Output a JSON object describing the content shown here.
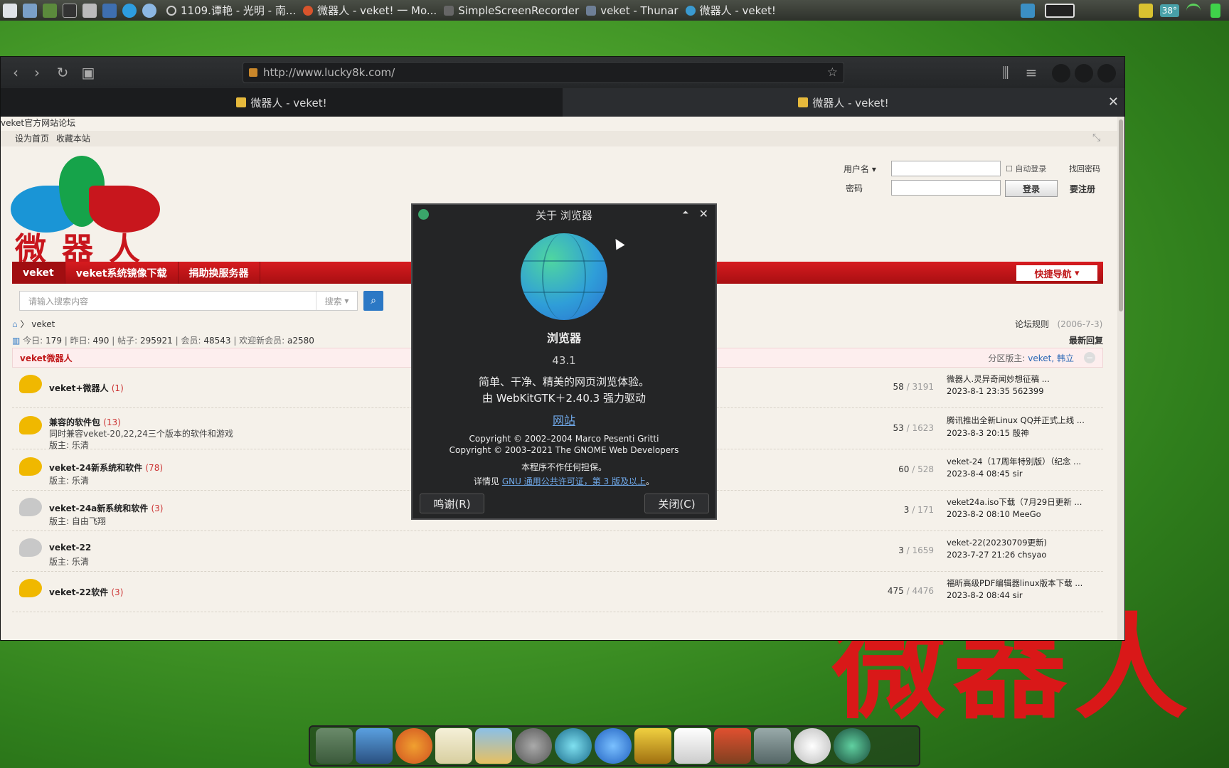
{
  "panel": {
    "tasks": [
      "1109.谭艳 - 光明 - 南...",
      "微器人 - veket! 一 Mo...",
      "SimpleScreenRecorder",
      "veket - Thunar",
      "微器人 - veket!"
    ],
    "temp": "38°"
  },
  "browser": {
    "url": "http://www.lucky8k.com/",
    "tabs": [
      "微器人 - veket!",
      "微器人 - veket!"
    ]
  },
  "site": {
    "top_text": "veket官方网站论坛",
    "header_links": "设为首页 收藏本站",
    "brand": "微器人",
    "login": {
      "user_label": "用户名",
      "pass_label": "密码",
      "auto_login": "自动登录",
      "find_pw": "找回密码",
      "login_btn": "登录",
      "register": "要注册"
    },
    "nav": [
      "veket",
      "veket系统镜像下载",
      "捐助换服务器"
    ],
    "quick_nav": "快捷导航",
    "search": {
      "placeholder": "请输入搜索内容",
      "type": "搜索"
    },
    "breadcrumb": "veket",
    "rules": "论坛规则",
    "rules_date": "(2006-7-3)",
    "stats": {
      "today_l": "今日:",
      "today": "179",
      "yest_l": "昨日:",
      "yest": "490",
      "posts_l": "帖子:",
      "posts": "295921",
      "members_l": "会员:",
      "members": "48543",
      "welcome_l": "欢迎新会员:",
      "newest": "a2580"
    },
    "latest_reply": "最新回复",
    "section": {
      "title": "veket微器人",
      "mods_label": "分区版主:",
      "mods": "veket, 韩立"
    },
    "forums": [
      {
        "name": "veket+微器人",
        "count": "(1)",
        "desc": "",
        "mod": "",
        "threads": "58",
        "posts": "3191",
        "last": "微器人.灵异奇闻妙想征稿 ...",
        "last_meta": "2023-8-1 23:35 562399",
        "icon": "#f0b800"
      },
      {
        "name": "兼容的软件包",
        "count": "(13)",
        "desc": "同时兼容veket-20,22,24三个版本的软件和游戏",
        "mod": "版主: 乐清",
        "threads": "53",
        "posts": "1623",
        "last": "腾讯推出全新Linux QQ并正式上线 ...",
        "last_meta": "2023-8-3 20:15 殷神",
        "icon": "#f0b800"
      },
      {
        "name": "veket-24新系统和软件",
        "count": "(78)",
        "desc": "",
        "mod": "版主: 乐清",
        "threads": "60",
        "posts": "528",
        "last": "veket-24（17周年特别版）（纪念 ...",
        "last_meta": "2023-8-4 08:45 sir",
        "icon": "#f0b800"
      },
      {
        "name": "veket-24a新系统和软件",
        "count": "(3)",
        "desc": "",
        "mod": "版主: 自由飞翔",
        "threads": "3",
        "posts": "171",
        "last": "veket24a.iso下载（7月29日更新 ...",
        "last_meta": "2023-8-2 08:10 MeeGo",
        "icon": "#c8c8c8"
      },
      {
        "name": "veket-22",
        "count": "",
        "desc": "",
        "mod": "版主: 乐清",
        "threads": "3",
        "posts": "1659",
        "last": "veket-22(20230709更新)",
        "last_meta": "2023-7-27 21:26 chsyao",
        "icon": "#c8c8c8"
      },
      {
        "name": "veket-22软件",
        "count": "(3)",
        "desc": "",
        "mod": "",
        "threads": "475",
        "posts": "4476",
        "last": "福昕高级PDF编辑器linux版本下载 ...",
        "last_meta": "2023-8-2 08:44 sir",
        "icon": "#f0b800"
      }
    ]
  },
  "dialog": {
    "title": "关于 浏览器",
    "app": "浏览器",
    "version": "43.1",
    "desc1": "简单、干净、精美的网页浏览体验。",
    "desc2": "由 WebKitGTK＋2.40.3 强力驱动",
    "website": "网站",
    "copy1": "Copyright © 2002–2004 Marco Pesenti Gritti",
    "copy2": "Copyright © 2003–2021 The GNOME Web Developers",
    "warranty": "本程序不作任何担保。",
    "license_pre": "详情见",
    "license_link": "GNU 通用公共许可证，第 3 版及以上",
    "license_post": "。",
    "credits": "鸣谢(R)",
    "close": "关闭(C)"
  },
  "wallpaper_text": "微器人"
}
